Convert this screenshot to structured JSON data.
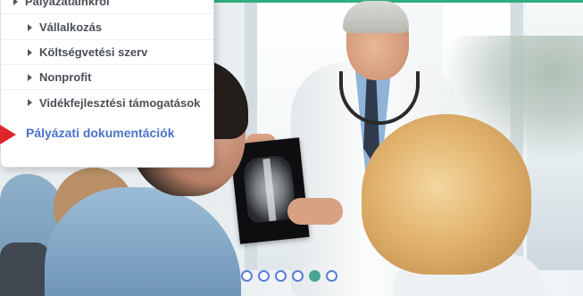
{
  "menu": {
    "parent_label": "Pályázatainkról",
    "items": [
      {
        "label": "Vállalkozás"
      },
      {
        "label": "Költségvetési szerv"
      },
      {
        "label": "Nonprofit"
      },
      {
        "label": "Vidékfejlesztési támogatások"
      }
    ],
    "highlighted_label": "Pályázati dokumentációk"
  },
  "slider": {
    "dot_count": 6,
    "active_index": 4
  },
  "colors": {
    "accent_blue": "#4a73c9",
    "arrow_red": "#e0242c",
    "active_dot": "#4aa596",
    "top_accent": "#2fae7f"
  }
}
